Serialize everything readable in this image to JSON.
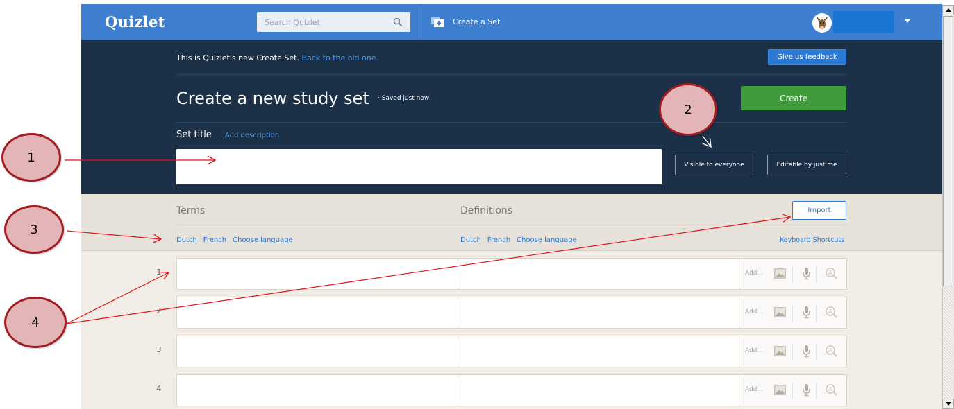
{
  "topbar": {
    "logo": "Quizlet",
    "search_placeholder": "Search Quizlet",
    "create_set_label": "Create a Set",
    "brand_color": "#3f7fd0"
  },
  "header": {
    "notice_text": "This is Quizlet's new Create Set.",
    "notice_link": "Back to the old one.",
    "feedback_label": "Give us feedback",
    "page_title": "Create a new study set",
    "saved_status": "· Saved just now",
    "create_label": "Create",
    "set_title_label": "Set title",
    "add_description_label": "Add description",
    "title_value": "",
    "visibility_label": "Visible to everyone",
    "editable_label": "Editable by just me",
    "background_color": "#1c3148",
    "create_color": "#3f9b3c"
  },
  "columns": {
    "terms_heading": "Terms",
    "definitions_heading": "Definitions",
    "import_label": "Import",
    "term_languages": [
      "Dutch",
      "French",
      "Choose language"
    ],
    "definition_languages": [
      "Dutch",
      "French",
      "Choose language"
    ],
    "keyboard_shortcuts_label": "Keyboard Shortcuts"
  },
  "cards": [
    {
      "number": "1",
      "term": "",
      "definition": "",
      "add_label": "Add..."
    },
    {
      "number": "2",
      "term": "",
      "definition": "",
      "add_label": "Add..."
    },
    {
      "number": "3",
      "term": "",
      "definition": "",
      "add_label": "Add..."
    },
    {
      "number": "4",
      "term": "",
      "definition": "",
      "add_label": "Add..."
    }
  ],
  "card_tools": [
    "image-icon",
    "microphone-icon",
    "search-image-icon"
  ],
  "annotations": {
    "callouts": [
      "1",
      "2",
      "3",
      "4"
    ],
    "callout_fill": "#e3b5b7",
    "callout_border": "#a31d22",
    "arrow_color": "#e0141a"
  }
}
